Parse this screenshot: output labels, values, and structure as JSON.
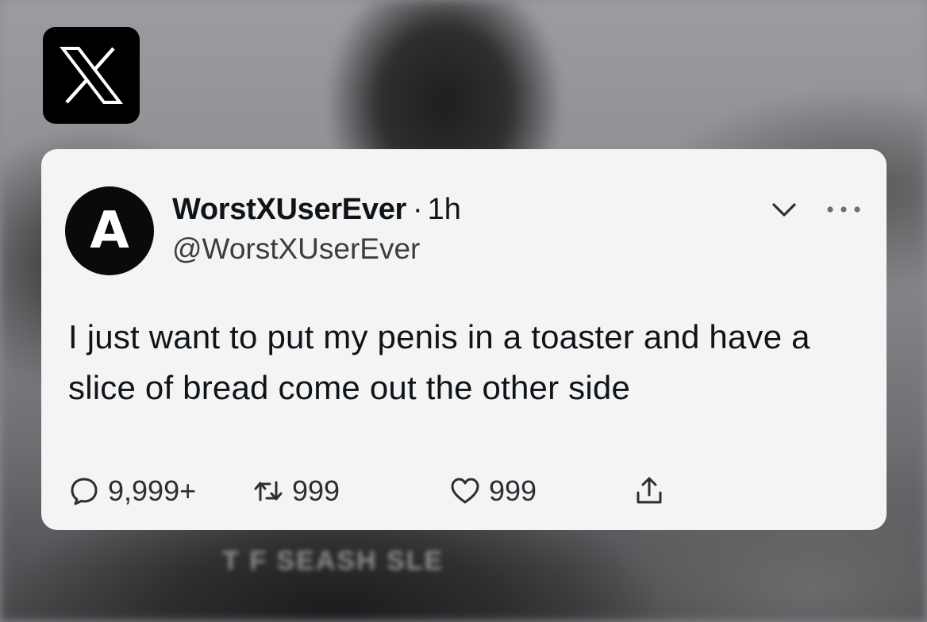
{
  "app": {
    "logo_icon": "x-logo-icon"
  },
  "background": {
    "caption": "T F SEASH SLE"
  },
  "post": {
    "avatar_letter": "A",
    "display_name": "WorstXUserEver",
    "separator": "·",
    "time": "1h",
    "handle": "@WorstXUserEver",
    "text": "I just want to put my penis in a toaster and have a slice of bread come out the other side",
    "menu_icons": [
      "chevron-down-icon",
      "more-options-icon"
    ],
    "actions": {
      "replies": {
        "icon": "reply-icon",
        "count": "9,999+"
      },
      "reposts": {
        "icon": "repost-icon",
        "count": "999"
      },
      "likes": {
        "icon": "heart-icon",
        "count": "999"
      },
      "share": {
        "icon": "share-icon"
      }
    }
  },
  "colors": {
    "card_bg": "#f4f4f4",
    "text": "#0f1419",
    "logo_bg": "#000000"
  }
}
